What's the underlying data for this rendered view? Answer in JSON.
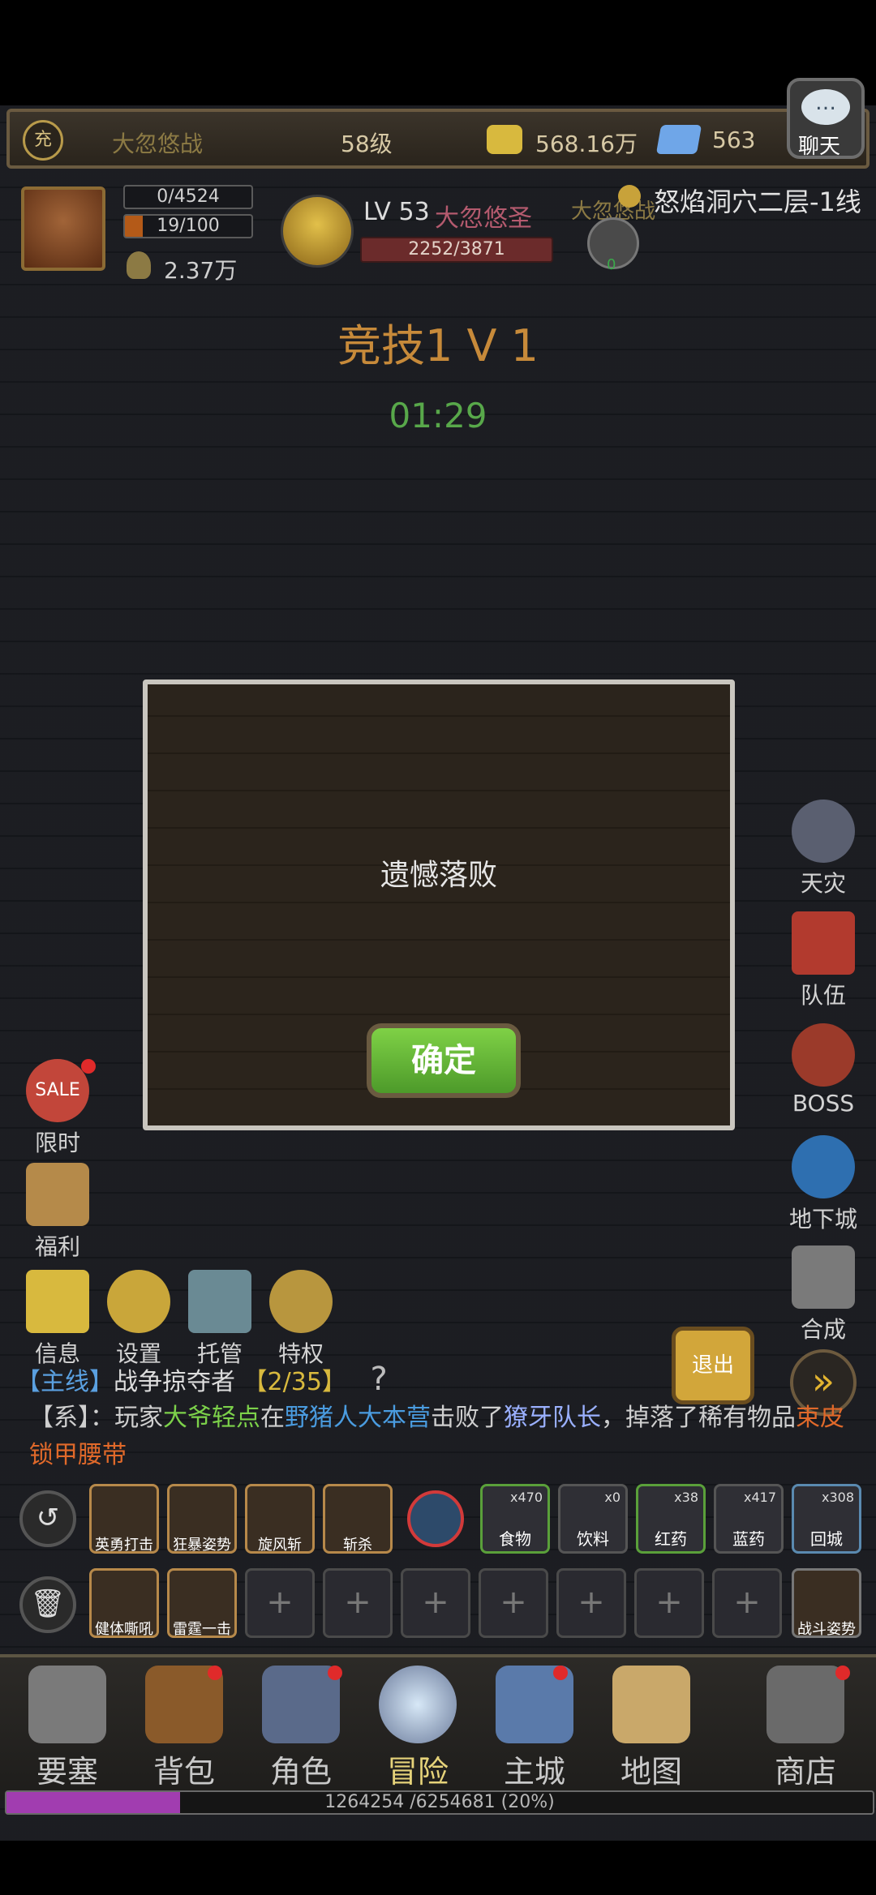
{
  "top_bar": {
    "charge_icon_text": "充",
    "player_name": "大忽悠战",
    "level": "58级",
    "gold": "568.16万",
    "diamonds": "563",
    "chat_label": "聊天"
  },
  "player_stats": {
    "stat_a": "0/4524",
    "stat_b": "19/100",
    "power": "2.37万"
  },
  "target": {
    "level": "LV 53",
    "name": "大忽悠圣",
    "hp": "2252/3871",
    "ally_name": "大忽悠战",
    "ally_count": "0"
  },
  "location": "怒焰洞穴二层-1线",
  "arena": {
    "title": "竞技1 V 1",
    "timer": "01:29"
  },
  "modal": {
    "message": "遗憾落败",
    "confirm_label": "确定"
  },
  "right_menu": [
    "天灾",
    "队伍",
    "BOSS",
    "地下城",
    "合成"
  ],
  "left_menu": {
    "limited": "限时",
    "welfare": "福利",
    "sale_text": "SALE"
  },
  "tool_row": [
    "信息",
    "设置",
    "托管",
    "特权"
  ],
  "quest": {
    "tag": "【主线】",
    "name": "战争掠夺者",
    "progress": "【2/35】",
    "help": "?"
  },
  "log": {
    "prefix": "【系】：",
    "p1": "玩家",
    "player": "大爷轻点",
    "p2": "在",
    "place": "野猪人大本营",
    "p3": "击败了",
    "boss": "獠牙队长",
    "p4": "，掉落了稀有物品",
    "item": "束皮锁甲腰带"
  },
  "exit_label": "退出",
  "skills_row1": [
    "英勇打击",
    "狂暴姿势",
    "旋风斩",
    "斩杀"
  ],
  "items_row1": [
    {
      "name": "食物",
      "count": "x470"
    },
    {
      "name": "饮料",
      "count": "x0"
    },
    {
      "name": "红药",
      "count": "x38"
    },
    {
      "name": "蓝药",
      "count": "x417"
    },
    {
      "name": "回城",
      "count": "x308"
    }
  ],
  "skills_row2": [
    "健体嘶吼",
    "雷霆一击"
  ],
  "slot_plus": "+",
  "battle_stance": "战斗姿势",
  "bottom_nav": [
    "要塞",
    "背包",
    "角色",
    "冒险",
    "主城",
    "地图",
    "商店"
  ],
  "xp": {
    "text": "1264254 /6254681 (20%)",
    "fraction": 0.2
  },
  "colors": {
    "accent_green": "#58a84a",
    "player_green": "#7cd14a",
    "place_blue": "#4a9ce0",
    "boss_purple": "#9ab0ff",
    "item_orange": "#e0692a",
    "quest_blue": "#5aa0e0",
    "gold_tan": "#b39a4a"
  }
}
